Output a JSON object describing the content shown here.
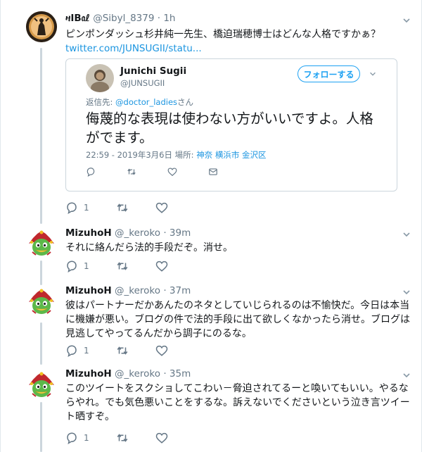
{
  "tweets": [
    {
      "avatar_label": "SIBYL",
      "name": "ዛIB𝔞ℓ",
      "handle": "@Sibyl_8379",
      "dot": "·",
      "time": "1h",
      "text": "ピンポンダッシュ杉井純一先生、橋迫瑞穂博士はどんな人格ですかぁ？",
      "link": "twitter.com/JUNSUGII/statu...",
      "reply_count": "1",
      "retweet_count": "",
      "like_count": ""
    },
    {
      "name": "MizuhoH",
      "handle": "@_keroko",
      "dot": "·",
      "time": "39m",
      "text": "それに絡んだら法的手段だぞ。消せ。",
      "reply_count": "1"
    },
    {
      "name": "MizuhoH",
      "handle": "@_keroko",
      "dot": "·",
      "time": "37m",
      "text": "彼はパートナーだかあんたのネタとしていじられるのは不愉快だ。今日は本当に機嫌が悪い。ブログの件で法的手段に出て欲しくなかったら消せ。ブログは見逃してやってるんだから調子にのるな。",
      "reply_count": "1"
    },
    {
      "name": "MizuhoH",
      "handle": "@_keroko",
      "dot": "·",
      "time": "35m",
      "text": "このツイートをスクショしてこわい－脅迫されてるーと喚いてもいい。やるならやれ。でも気色悪いことをするな。訴えないでくださいという泣き言ツイート晒すぞ。",
      "reply_count": "1"
    }
  ],
  "quoted": {
    "name": "Junichi Sugii",
    "handle": "@JUNSUGII",
    "follow_label": "フォローする",
    "reply_prefix": "返信先: ",
    "reply_mention": "@doctor_ladies",
    "reply_suffix": "さん",
    "text": "侮蔑的な表現は使わない方がいいですよ。人格がでます。",
    "meta_time": "22:59 - 2019年3月6日 場所: ",
    "meta_location": "神奈 横浜市 金沢区"
  },
  "colors": {
    "accent": "#1da1f2",
    "link": "#1b95e0",
    "muted": "#657786",
    "thread_line": "#ccd6dd"
  },
  "icons": [
    "reply-icon",
    "retweet-icon",
    "like-icon",
    "mail-icon",
    "chevron-down-icon"
  ]
}
